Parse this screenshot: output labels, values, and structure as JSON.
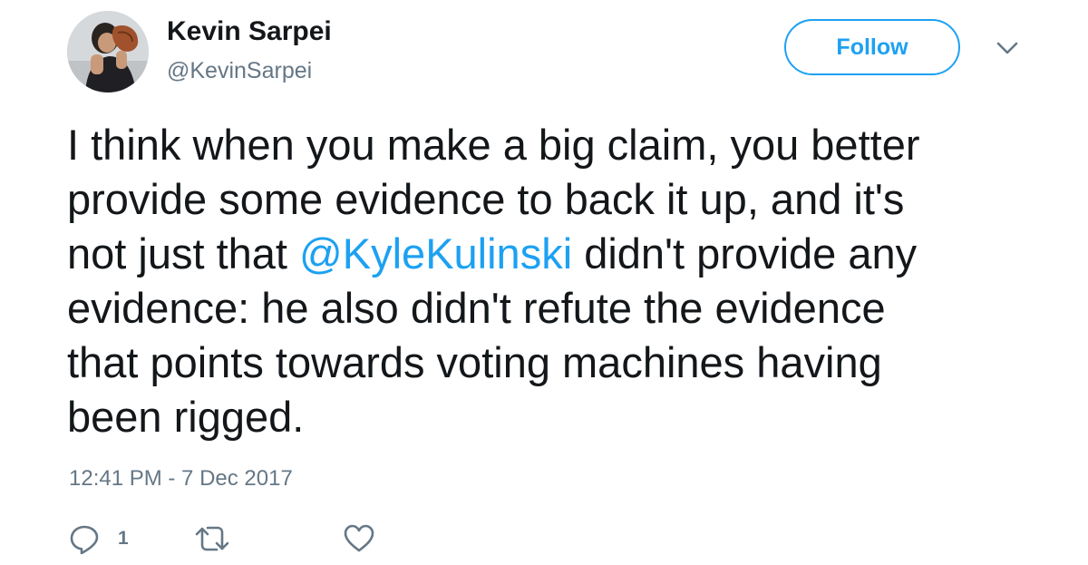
{
  "user": {
    "display_name": "Kevin Sarpei",
    "handle": "@KevinSarpei",
    "avatar_icon": "profile-photo"
  },
  "header": {
    "follow_label": "Follow",
    "menu_icon": "chevron-down-icon"
  },
  "tweet": {
    "lines": [
      "I think when you make a big claim, you better",
      "provide some evidence to back it up, and it's",
      "not just that ",
      " didn't provide any",
      "evidence: he also didn't refute the evidence",
      "that points towards voting machines having",
      "been rigged."
    ],
    "mention": "@KyleKulinski",
    "timestamp": "12:41 PM - 7 Dec 2017"
  },
  "actions": {
    "reply_icon": "reply-icon",
    "reply_count": "1",
    "retweet_icon": "retweet-icon",
    "like_icon": "heart-icon"
  },
  "colors": {
    "accent": "#1da1f2",
    "text": "#14171a",
    "muted": "#657786"
  }
}
